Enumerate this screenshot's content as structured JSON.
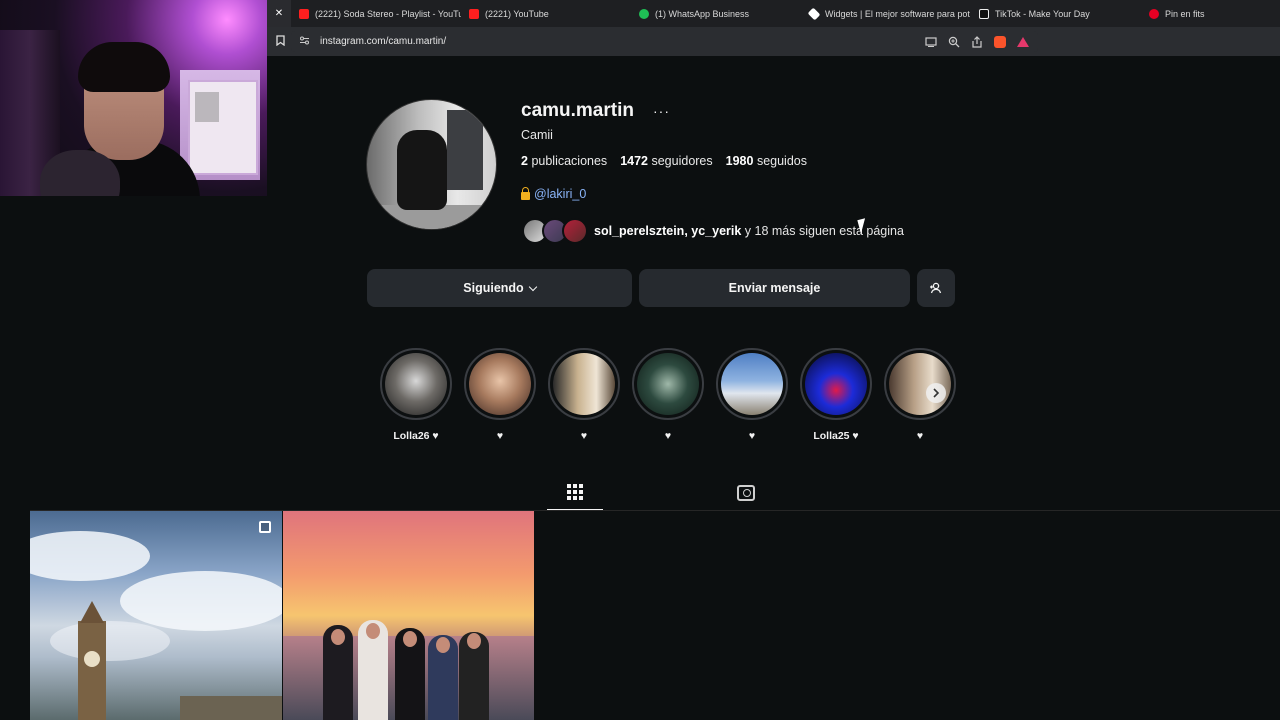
{
  "browser": {
    "tabs": [
      {
        "title": "(2221) Soda Stereo - Playlist - YouTub",
        "icon": "youtube-icon"
      },
      {
        "title": "(2221) YouTube",
        "icon": "youtube-icon"
      },
      {
        "title": "(1) WhatsApp Business",
        "icon": "whatsapp-icon"
      },
      {
        "title": "Widgets | El mejor software para pot",
        "icon": "widgets-icon"
      },
      {
        "title": "TikTok - Make Your Day",
        "icon": "tiktok-icon"
      },
      {
        "title": "Pin en fits",
        "icon": "pinterest-icon"
      }
    ],
    "close_glyph": "✕",
    "url": "instagram.com/camu.martin/"
  },
  "profile": {
    "username": "camu.martin",
    "more_glyph": "···",
    "full_name": "Camii",
    "posts_count": "2",
    "posts_label": "publicaciones",
    "followers_count": "1472",
    "followers_label": "seguidores",
    "following_count": "1980",
    "following_label": "seguidos",
    "bio_link": "@lakiri_0",
    "followed_by_names": "sol_perelsztein, yc_yerik",
    "followed_by_rest": " y 18 más siguen esta página"
  },
  "actions": {
    "following_label": "Siguiendo",
    "message_label": "Enviar mensaje",
    "add_user_icon": "add-user-icon"
  },
  "highlights": [
    {
      "label": "Lolla26 ♥",
      "color": "#6d6a66"
    },
    {
      "label": "♥",
      "color": "#a77a5e"
    },
    {
      "label": "♥",
      "color": "#c9b28f"
    },
    {
      "label": "♥",
      "color": "#2d4a3f"
    },
    {
      "label": "♥",
      "color": "#8fb3e0"
    },
    {
      "label": "Lolla25 ♥",
      "color": "#1c2bd8"
    },
    {
      "label": "♥",
      "color": "#b79f86"
    }
  ],
  "colors": {
    "background": "#0c0f10",
    "button": "#262a2f",
    "link": "#8ab4f8"
  }
}
